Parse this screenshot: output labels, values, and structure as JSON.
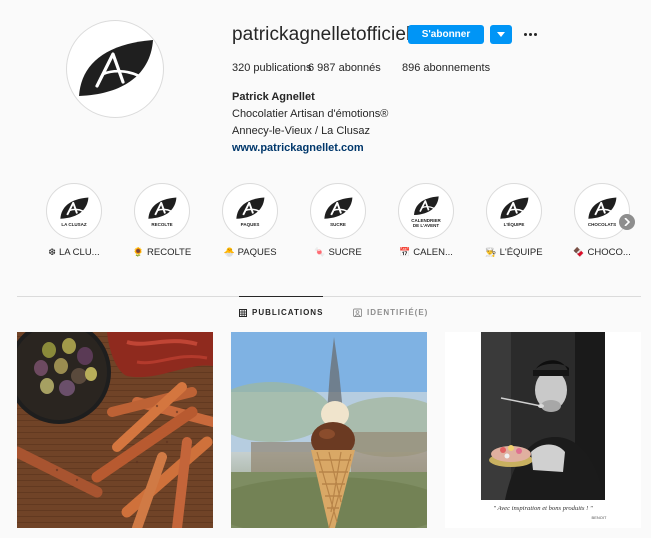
{
  "profile": {
    "username": "patrickagnelletofficiel",
    "follow_label": "S'abonner",
    "stats": {
      "posts": "320 publications",
      "followers": "6 987 abonnés",
      "following": "896 abonnements"
    },
    "bio": {
      "name": "Patrick Agnellet",
      "line1": "Chocolatier Artisan d'émotions®",
      "line2": "Annecy-le-Vieux / La Clusaz",
      "website": "www.patrickagnellet.com"
    }
  },
  "highlights": [
    {
      "emoji": "❆",
      "label": "LA CLU...",
      "sub": "LA CLUSAZ"
    },
    {
      "emoji": "🌻",
      "label": "RECOLTE",
      "sub": "RECOLTE"
    },
    {
      "emoji": "🐣",
      "label": "PAQUES",
      "sub": "PAQUES"
    },
    {
      "emoji": "🍬",
      "label": "SUCRE",
      "sub": "SUCRE"
    },
    {
      "emoji": "📅",
      "label": "CALEN...",
      "sub": "CALENDRIER\nDE L'AVENT"
    },
    {
      "emoji": "👨‍🍳",
      "label": "L'ÉQUIPE",
      "sub": "L'ÉQUIPE"
    },
    {
      "emoji": "🍫",
      "label": "CHOCO...",
      "sub": "CHOCOLATS"
    }
  ],
  "tabs": {
    "posts": "PUBLICATIONS",
    "tagged": "IDENTIFIÉ(E)"
  },
  "posts": {
    "quote": "\" Avec inspiration et bons produits ! \"",
    "signature": "BENOIT"
  },
  "colors": {
    "accent": "#0095f6",
    "link": "#00376b",
    "text": "#262626",
    "muted": "#8e8e8e",
    "border": "#dbdbdb"
  },
  "icons": {
    "logo": "leaf-a-logo-icon",
    "dropdown": "chevron-down-icon",
    "more": "more-dots-icon",
    "next": "chevron-right-icon",
    "grid": "grid-icon",
    "tag": "tag-person-icon"
  }
}
